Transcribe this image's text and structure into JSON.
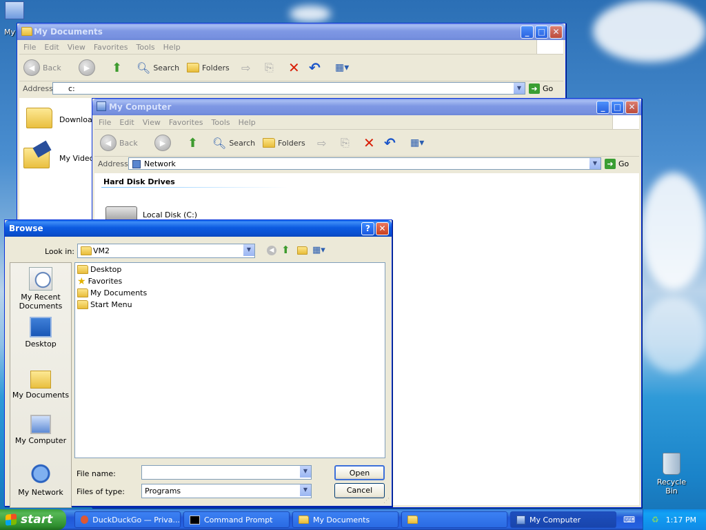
{
  "desktop": {
    "recycle_bin_label": "Recycle Bin",
    "top_left_label": "My"
  },
  "mydocs_window": {
    "title": "My Documents",
    "menu": [
      "File",
      "Edit",
      "View",
      "Favorites",
      "Tools",
      "Help"
    ],
    "toolbar": {
      "back": "Back",
      "search": "Search",
      "folders": "Folders"
    },
    "address_label": "Address",
    "address_value": "c:",
    "go_label": "Go",
    "items": [
      "Downloads",
      "My Videos"
    ]
  },
  "mycomputer_window": {
    "title": "My Computer",
    "menu": [
      "File",
      "Edit",
      "View",
      "Favorites",
      "Tools",
      "Help"
    ],
    "toolbar": {
      "back": "Back",
      "search": "Search",
      "folders": "Folders"
    },
    "address_label": "Address",
    "address_value": "Network",
    "go_label": "Go",
    "section_header": "Hard Disk Drives",
    "drive_label": "Local Disk (C:)"
  },
  "browse_dialog": {
    "title": "Browse",
    "look_in_label": "Look in:",
    "look_in_value": "VM2",
    "places": [
      "My Recent Documents",
      "Desktop",
      "My Documents",
      "My Computer",
      "My Network"
    ],
    "files": [
      "Desktop",
      "Favorites",
      "My Documents",
      "Start Menu"
    ],
    "file_name_label": "File name:",
    "file_name_value": "",
    "files_of_type_label": "Files of type:",
    "files_of_type_value": "Programs",
    "open_label": "Open",
    "cancel_label": "Cancel"
  },
  "taskbar": {
    "start_label": "start",
    "buttons": [
      "DuckDuckGo — Priva...",
      "Command Prompt",
      "My Documents",
      "",
      "My Computer"
    ],
    "clock": "1:17 PM"
  }
}
